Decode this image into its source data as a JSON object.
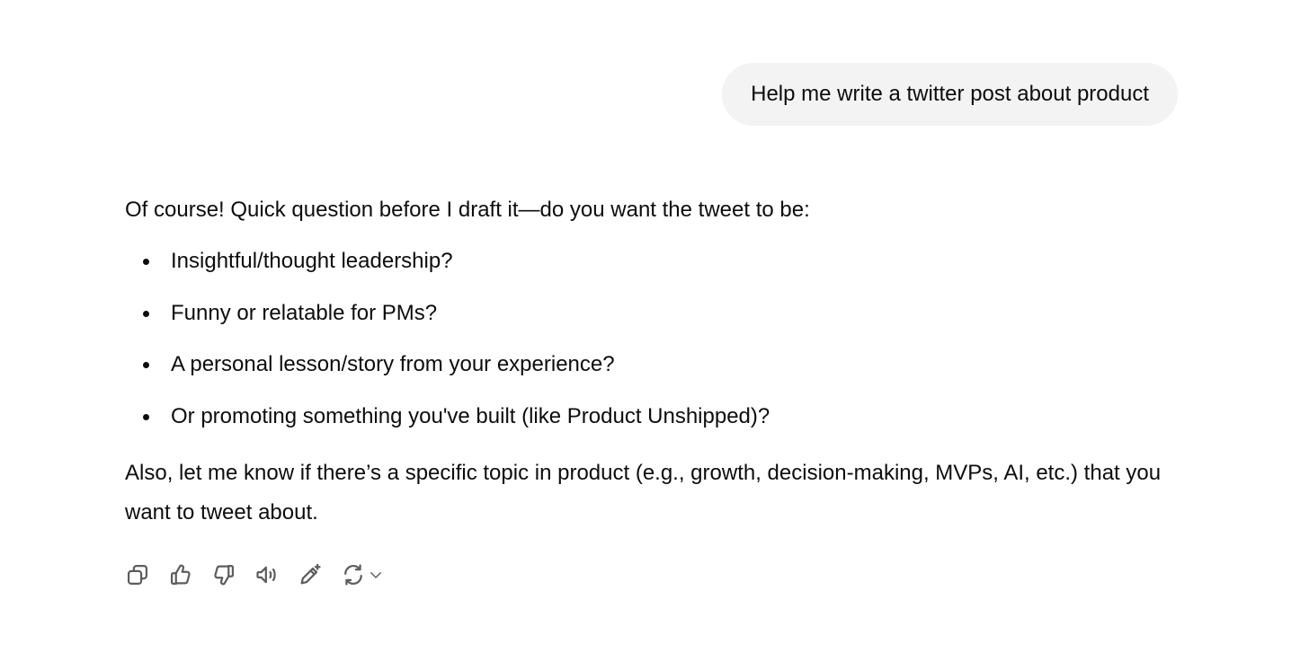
{
  "user_message": {
    "text": "Help me write a twitter post about product"
  },
  "assistant_message": {
    "intro": "Of course! Quick question before I draft it—do you want the tweet to be:",
    "options": [
      "Insightful/thought leadership?",
      "Funny or relatable for PMs?",
      "A personal lesson/story from your experience?",
      "Or promoting something you've built (like Product Unshipped)?"
    ],
    "followup": "Also, let me know if there’s a specific topic in product (e.g., growth, decision-making, MVPs, AI, etc.) that you want to tweet about."
  },
  "action_bar": {
    "icons": [
      "copy-icon",
      "thumbs-up-icon",
      "thumbs-down-icon",
      "read-aloud-icon",
      "edit-in-canvas-icon",
      "regenerate-icon",
      "chevron-down-icon"
    ]
  },
  "colors": {
    "text": "#0d0d0d",
    "bubble_background": "#f3f3f3",
    "icon": "#5d5d5d"
  }
}
